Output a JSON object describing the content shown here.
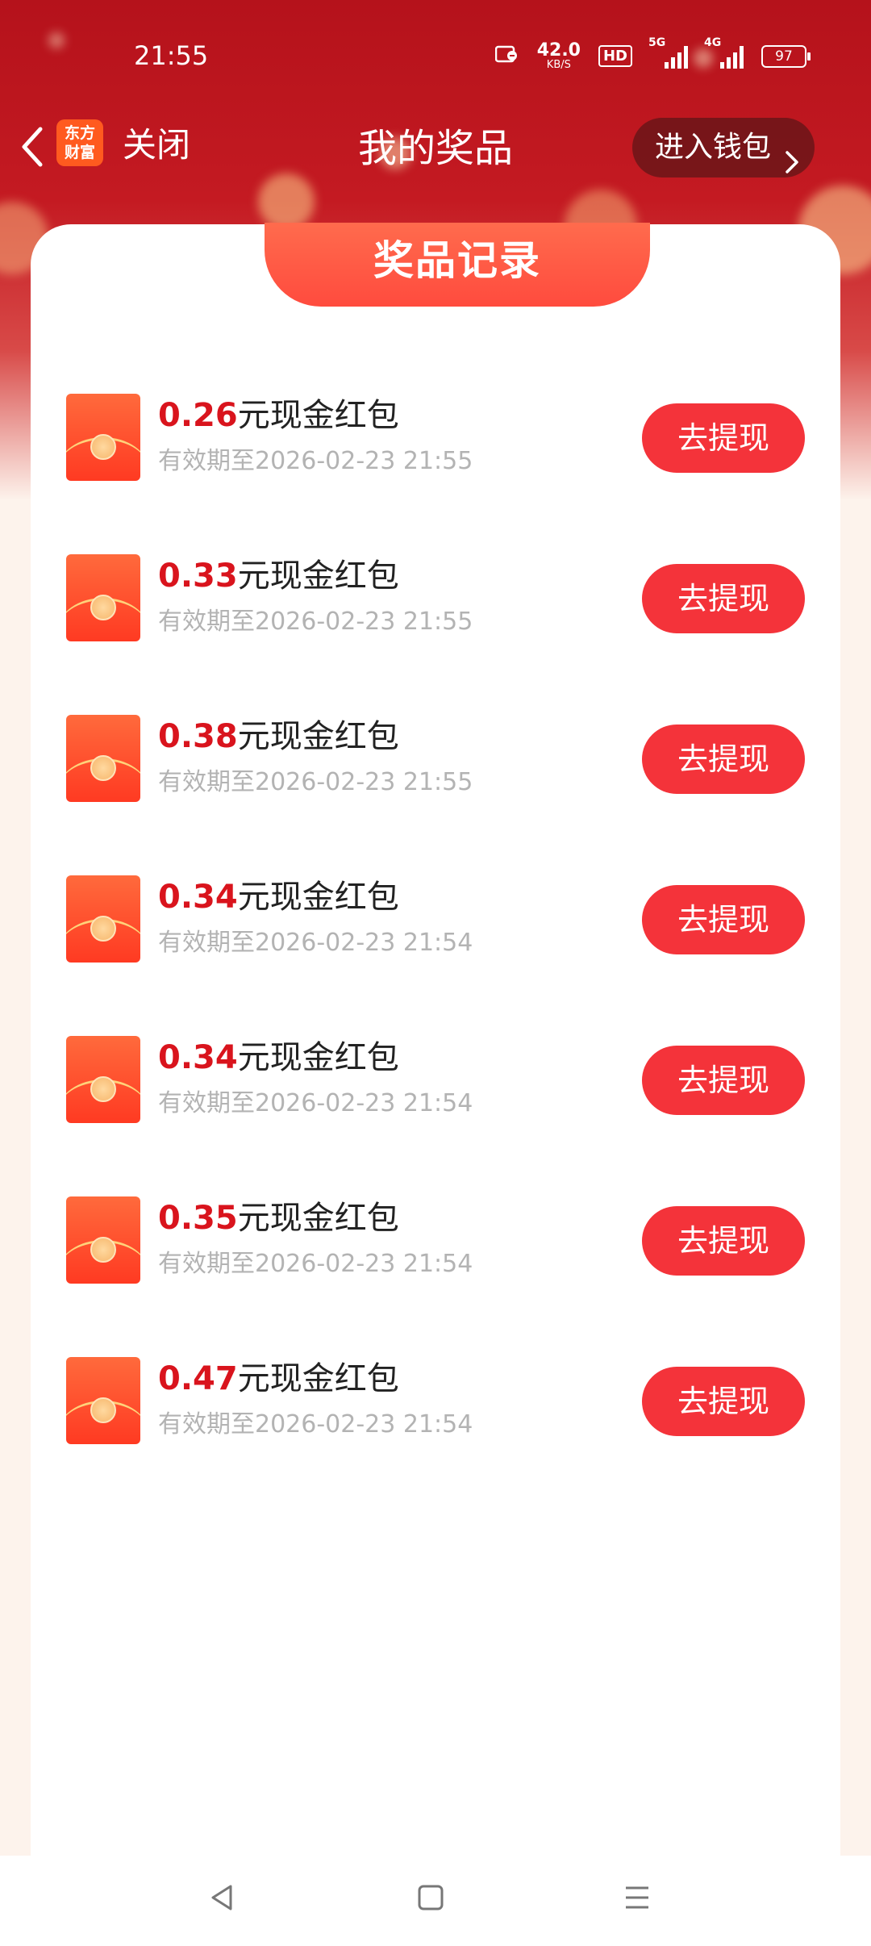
{
  "status_bar": {
    "time": "21:55",
    "net_speed_value": "42.0",
    "net_speed_unit": "KB/S",
    "hd_label": "HD",
    "signal1_label": "5G",
    "signal2_label": "4G",
    "battery": "97"
  },
  "title_bar": {
    "logo_text_line1": "东方",
    "logo_text_line2": "财富",
    "close_label": "关闭",
    "title": "我的奖品",
    "wallet_button": "进入钱包"
  },
  "card": {
    "tab_title": "奖品记录",
    "items": [
      {
        "amount": "0.26",
        "suffix": "元现金红包",
        "expiry": "有效期至2026-02-23 21:55",
        "button": "去提现"
      },
      {
        "amount": "0.33",
        "suffix": "元现金红包",
        "expiry": "有效期至2026-02-23 21:55",
        "button": "去提现"
      },
      {
        "amount": "0.38",
        "suffix": "元现金红包",
        "expiry": "有效期至2026-02-23 21:55",
        "button": "去提现"
      },
      {
        "amount": "0.34",
        "suffix": "元现金红包",
        "expiry": "有效期至2026-02-23 21:54",
        "button": "去提现"
      },
      {
        "amount": "0.34",
        "suffix": "元现金红包",
        "expiry": "有效期至2026-02-23 21:54",
        "button": "去提现"
      },
      {
        "amount": "0.35",
        "suffix": "元现金红包",
        "expiry": "有效期至2026-02-23 21:54",
        "button": "去提现"
      },
      {
        "amount": "0.47",
        "suffix": "元现金红包",
        "expiry": "有效期至2026-02-23 21:54",
        "button": "去提现"
      }
    ]
  },
  "colors": {
    "header_red": "#c41a22",
    "amount_red": "#d9141d",
    "button_red": "#f4333a",
    "expiry_gray": "#b3b3b3"
  },
  "icons": {
    "back": "back-chevron-icon",
    "wallet_chevron": "chevron-right-icon",
    "envelope": "red-envelope-icon",
    "nav_back": "nav-back-icon",
    "nav_home": "nav-home-icon",
    "nav_menu": "nav-menu-icon"
  }
}
